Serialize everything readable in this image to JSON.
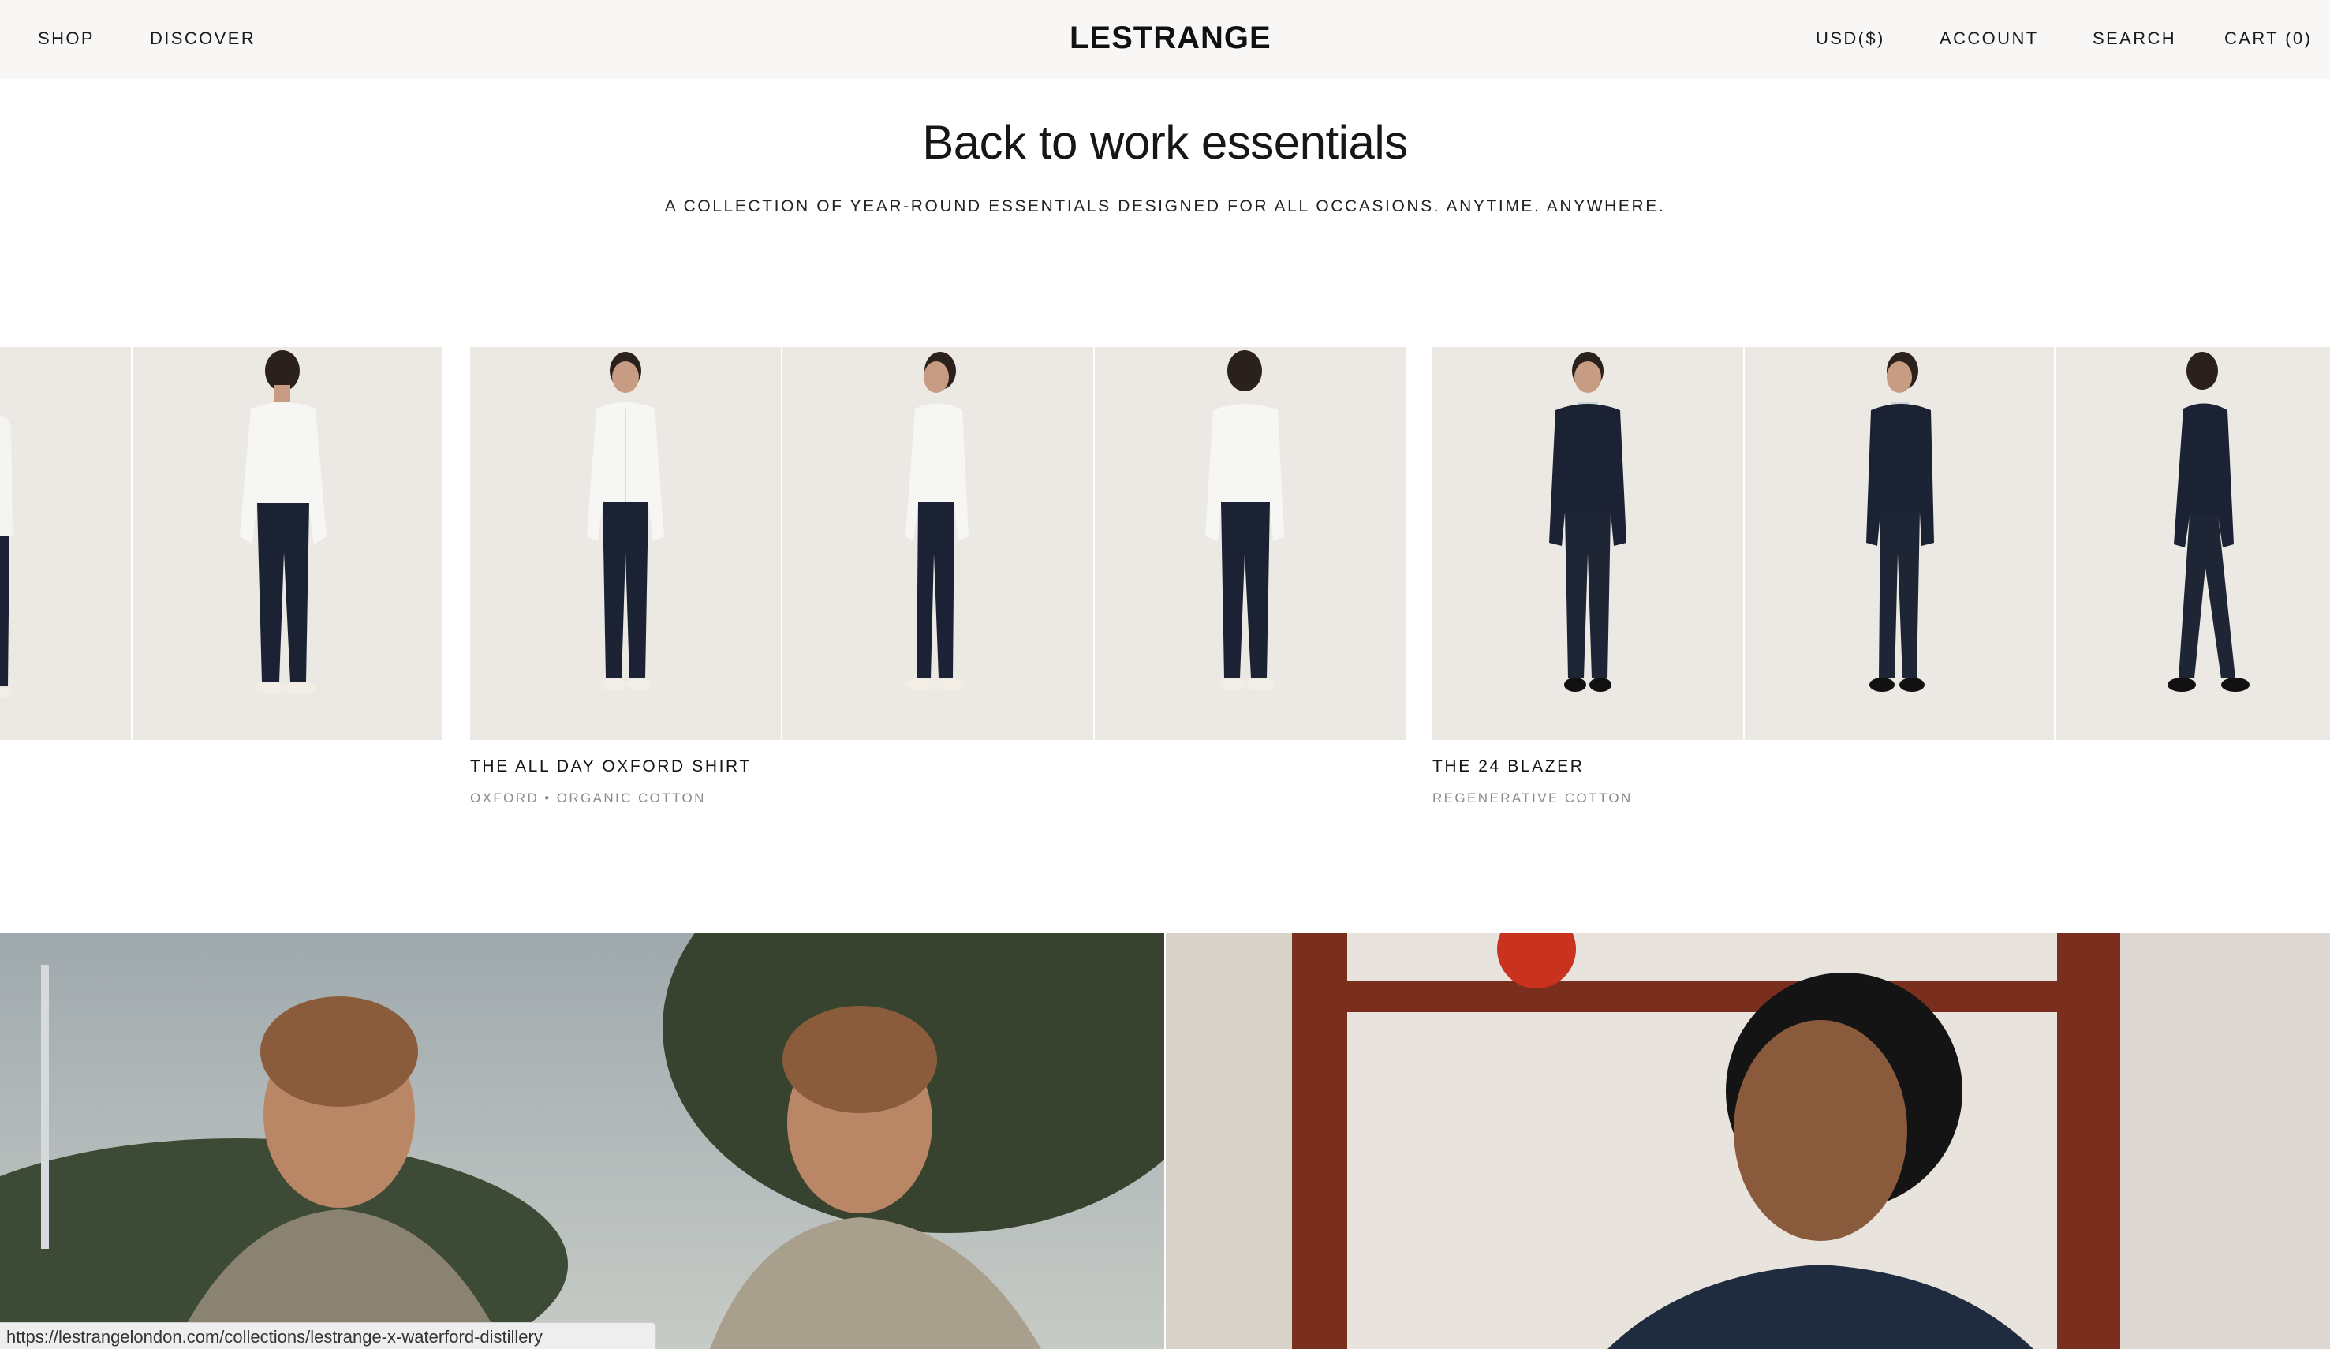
{
  "header": {
    "nav_left": [
      "SHOP",
      "DISCOVER"
    ],
    "logo": "LESTRANGE",
    "nav_right": [
      "USD($)",
      "ACCOUNT",
      "SEARCH",
      "CART (0)"
    ]
  },
  "hero": {
    "title": "Back to work essentials",
    "subtitle": "A COLLECTION OF YEAR-ROUND ESSENTIALS DESIGNED FOR ALL OCCASIONS. ANYTIME. ANYWHERE."
  },
  "products": [
    {
      "name": "THE ALL DAY OXFORD SHIRT",
      "meta": "OXFORD • ORGANIC COTTON"
    },
    {
      "name": "THE 24 BLAZER",
      "meta": "REGENERATIVE COTTON"
    }
  ],
  "status_bar": {
    "url": "https://lestrangelondon.com/collections/lestrange-x-waterford-distillery"
  },
  "colors": {
    "header_bg": "#f8f7f6",
    "tile_bg": "#ece9e4",
    "navy": "#1b2233",
    "shirt_white": "#f4f4f2"
  }
}
